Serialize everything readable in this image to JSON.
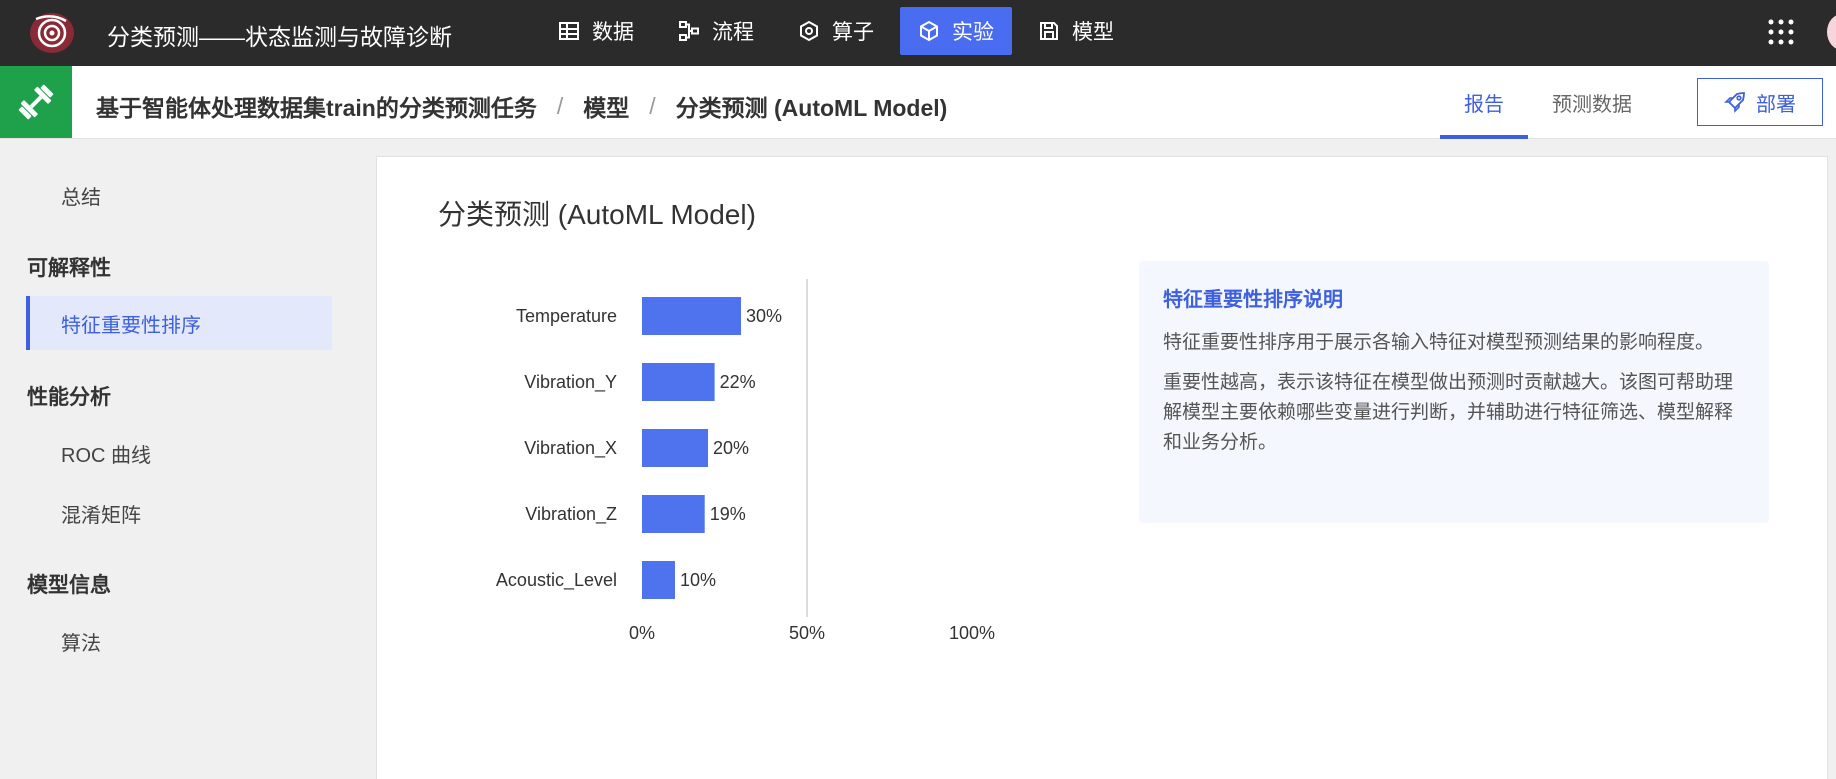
{
  "app": {
    "title": "分类预测——状态监测与故障诊断"
  },
  "nav": {
    "items": [
      {
        "label": "数据",
        "icon": "table-icon"
      },
      {
        "label": "流程",
        "icon": "flow-icon"
      },
      {
        "label": "算子",
        "icon": "hexagon-icon"
      },
      {
        "label": "实验",
        "icon": "cube-icon",
        "active": true
      },
      {
        "label": "模型",
        "icon": "save-icon"
      }
    ]
  },
  "breadcrumb": {
    "project": "基于智能体处理数据集train的分类预测任务",
    "sep1": "/",
    "section": "模型",
    "sep2": "/",
    "current": "分类预测 (AutoML Model)"
  },
  "tabs": {
    "report": "报告",
    "predict_data": "预测数据"
  },
  "deploy": {
    "label": "部署"
  },
  "sidebar": {
    "summary": "总结",
    "group_explain": "可解释性",
    "feature_rank": "特征重要性排序",
    "group_perf": "性能分析",
    "roc": "ROC 曲线",
    "confusion": "混淆矩阵",
    "group_info": "模型信息",
    "algorithm": "算法"
  },
  "main": {
    "title": "分类预测 (AutoML Model)"
  },
  "info": {
    "title": "特征重要性排序说明",
    "p1": "特征重要性排序用于展示各输入特征对模型预测结果的影响程度。",
    "p2": "重要性越高，表示该特征在模型做出预测时贡献越大。该图可帮助理解模型主要依赖哪些变量进行判断，并辅助进行特征筛选、模型解释和业务分析。"
  },
  "colors": {
    "accent": "#4a6cf0",
    "bar": "#4f73ee",
    "topbar": "#2b2b2b",
    "module": "#1fa04a"
  },
  "chart_data": {
    "type": "bar",
    "orientation": "horizontal",
    "categories": [
      "Temperature",
      "Vibration_Y",
      "Vibration_X",
      "Vibration_Z",
      "Acoustic_Level"
    ],
    "values": [
      30,
      22,
      20,
      19,
      10
    ],
    "data_labels": [
      "30%",
      "22%",
      "20%",
      "19%",
      "10%"
    ],
    "xlim": [
      0,
      100
    ],
    "ticks": [
      0,
      50,
      100
    ],
    "tick_labels": [
      "0%",
      "50%",
      "100%"
    ],
    "title": "",
    "xlabel": "",
    "ylabel": "",
    "grid": false
  }
}
